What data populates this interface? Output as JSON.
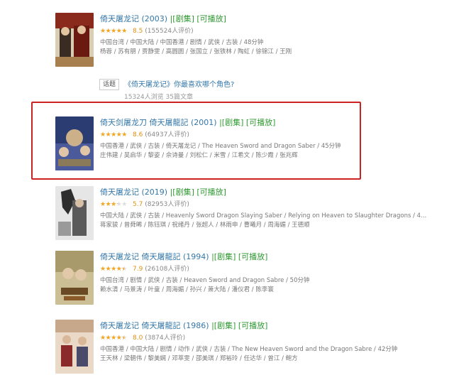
{
  "topic": {
    "badge": "话题",
    "title": "《倚天屠龙记》你最喜欢哪个角色?",
    "stats": "15324人浏览   35篇文章"
  },
  "results": [
    {
      "title": "倚天屠龙记",
      "year": "(2003)",
      "tags": [
        "[剧集]",
        "[可播放]"
      ],
      "rating": 8.5,
      "votes": "(155524人评价)",
      "meta1": "中国台湾 / 中国大陆 / 中国香港 / 剧情 / 武侠 / 古装 / 48分钟",
      "meta2": "杨蓉 / 苏有朋 / 贾静雯 / 高圆圆 / 张国立 / 张铁林 / 陶虹 / 徐锦江 / 王刚",
      "poster_colors": [
        "#7a1a14",
        "#d4c9b0"
      ]
    },
    {
      "title": "倚天剑屠龙刀 倚天屠龍記",
      "year": "(2001)",
      "tags": [
        "[剧集]",
        "[可播放]"
      ],
      "rating": 8.6,
      "votes": "(64937人评价)",
      "meta1": "中国香港 / 武侠 / 古装 / 倚天屠龙记 / The Heaven Sword and Dragon Saber / 45分钟",
      "meta2": "庄伟建 / 吴启华 / 黎姿 / 佘诗曼 / 刘松仁 / 米雪 / 江希文 / 陈少霞 / 张兆辉",
      "poster_colors": [
        "#2b3f78",
        "#b8a57a"
      ]
    },
    {
      "title": "倚天屠龙记",
      "year": "(2019)",
      "tags": [
        "[剧集]",
        "[可播放]"
      ],
      "rating": 5.7,
      "votes": "(82953人评价)",
      "meta1": "中国大陆 / 武侠 / 古装 / Heavenly Sword Dragon Slaying Saber / Relying on Heaven to Slaughter Dragons / 4...",
      "meta2": "蒋家骏 / 曾舜晞 / 陈钰琪 / 祝绪丹 / 张超人 / 林雨申 / 曹曦月 / 周海媚 / 王德顺",
      "poster_colors": [
        "#dcdcdc",
        "#3a3a3a"
      ]
    },
    {
      "title": "倚天屠龙记 倚天屠龍記",
      "year": "(1994)",
      "tags": [
        "[剧集]",
        "[可播放]"
      ],
      "rating": 7.9,
      "votes": "(26108人评价)",
      "meta1": "中国台湾 / 剧情 / 武侠 / 古装 / Heaven Sword and Dragon Sabre / 50分钟",
      "meta2": "赖水清 / 马景涛 / 叶童 / 周海媚 / 孙兴 / 萧大陆 / 潘仪君 / 陈李寰",
      "poster_colors": [
        "#c9b98e",
        "#5a4a2a"
      ]
    },
    {
      "title": "倚天屠龙记 倚天屠龍記",
      "year": "(1986)",
      "tags": [
        "[剧集]",
        "[可播放]"
      ],
      "rating": 8.0,
      "votes": "(3874人评价)",
      "meta1": "中国香港 / 中国大陆 / 剧情 / 动作 / 武侠 / 古装 / The New Heaven Sword and the Dragon Sabre / 42分钟",
      "meta2": "王天林 / 梁朝伟 / 黎美娴 / 邓萃雯 / 邵美琪 / 郑裕玲 / 任达华 / 曾江 / 鲍方",
      "poster_colors": [
        "#e8d8c8",
        "#8a2a2a"
      ]
    }
  ]
}
